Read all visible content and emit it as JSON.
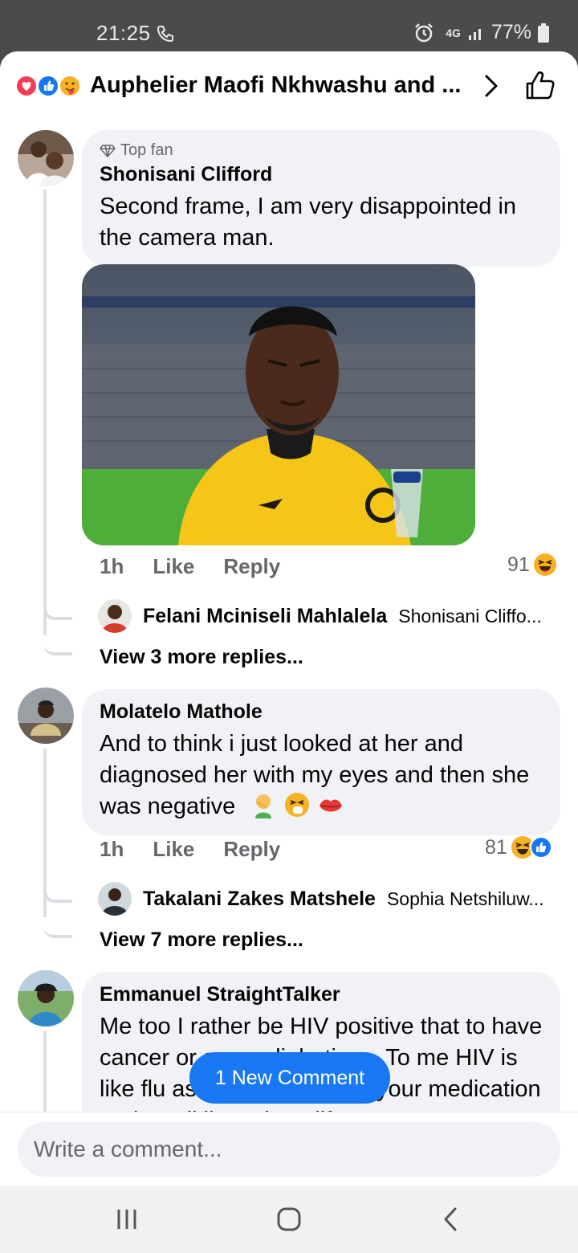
{
  "status_bar": {
    "time": "21:25",
    "network": "4G",
    "battery": "77%"
  },
  "header": {
    "title": "Auphelier Maofi Nkhwashu and ...",
    "reaction_icons": [
      "love-reaction",
      "like-reaction",
      "care-reaction"
    ]
  },
  "comments": [
    {
      "badge": "Top fan",
      "author": "Shonisani Clifford",
      "text": "Second frame, I am very disappointed in the camera man.",
      "time": "1h",
      "like_label": "Like",
      "reply_label": "Reply",
      "reaction_count": "91",
      "reply_preview": {
        "author": "Felani Mciniseli Mahlalela",
        "text": "Shonisani Cliffo..."
      },
      "view_more": "View 3 more replies..."
    },
    {
      "author": "Molatelo Mathole",
      "text": "And to think i just looked at her and diagnosed her with my eyes and then she was negative",
      "time": "1h",
      "like_label": "Like",
      "reply_label": "Reply",
      "reaction_count": "81",
      "reply_preview": {
        "author": "Takalani Zakes Matshele",
        "text": "Sophia Netshiluw..."
      },
      "view_more": "View 7 more replies..."
    },
    {
      "author": "Emmanuel StraightTalker",
      "text": "Me too I rather be HIV positive that to have cancer or sugar diabetics....To me HIV is like flu as long you stick to your medication and you'll live a long life"
    }
  ],
  "new_comment_label": "1 New Comment",
  "composer": {
    "placeholder": "Write a comment..."
  },
  "colors": {
    "accent": "#1877f2",
    "bubble": "#f0f2f5",
    "secondary_text": "#65676b"
  }
}
